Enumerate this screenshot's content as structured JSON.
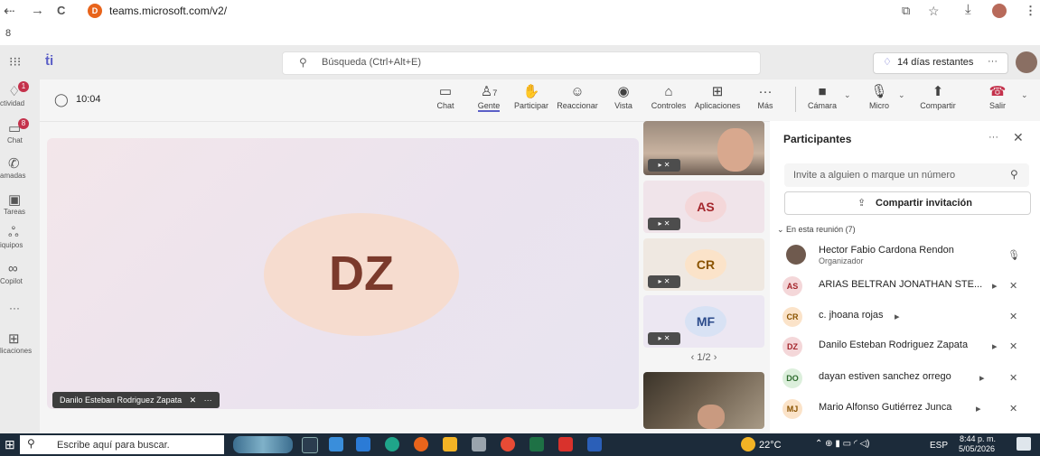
{
  "browser": {
    "back": "⇠",
    "forward": "→",
    "reload": "C",
    "url": "teams.microsoft.com/v2/",
    "favicon_letter": "D",
    "bookmark_glyph": "8"
  },
  "teams_header": {
    "search_placeholder": "Búsqueda (Ctrl+Alt+E)",
    "trial_text": "14 días restantes",
    "more": "···"
  },
  "rail": {
    "items": [
      {
        "label": "ctividad",
        "icon": "bell-icon",
        "badge": "1"
      },
      {
        "label": "Chat",
        "icon": "chat-icon",
        "badge": "8"
      },
      {
        "label": "amadas",
        "icon": "phone-icon",
        "badge": ""
      },
      {
        "label": "Tareas",
        "icon": "tasks-icon",
        "badge": ""
      },
      {
        "label": "iquipos",
        "icon": "teams-icon",
        "badge": ""
      },
      {
        "label": "Copilot",
        "icon": "copilot-icon",
        "badge": ""
      },
      {
        "label": "···",
        "icon": "more-icon",
        "badge": ""
      },
      {
        "label": "licaciones",
        "icon": "apps-icon",
        "badge": ""
      }
    ]
  },
  "meeting": {
    "timer": "10:04",
    "people_count": "7",
    "tools": [
      {
        "label": "Chat"
      },
      {
        "label": "Gente"
      },
      {
        "label": "Participar"
      },
      {
        "label": "Reaccionar"
      },
      {
        "label": "Vista"
      },
      {
        "label": "Controles"
      },
      {
        "label": "Aplicaciones"
      },
      {
        "label": "Más"
      },
      {
        "label": "Cámara"
      },
      {
        "label": "Micro"
      },
      {
        "label": "Compartir"
      },
      {
        "label": "Salir"
      }
    ]
  },
  "stage": {
    "initials": "DZ",
    "name": "Danilo Esteban Rodriguez Zapata",
    "more": "···"
  },
  "tiles": [
    {
      "initials": "",
      "kind": "video"
    },
    {
      "initials": "AS",
      "kind": "avatar"
    },
    {
      "initials": "CR",
      "kind": "avatar"
    },
    {
      "initials": "MF",
      "kind": "avatar"
    },
    {
      "initials": "",
      "kind": "video"
    }
  ],
  "pager": "1/2",
  "participants_pane": {
    "title": "Participantes",
    "invite_placeholder": "Invite a alguien o marque un número",
    "share_invite": "Compartir invitación",
    "section": "En esta reunión (7)",
    "people": [
      {
        "initials": "",
        "name": "Hector Fabio Cardona Rendon",
        "role": "Organizador"
      },
      {
        "initials": "AS",
        "name": "ARIAS BELTRAN JONATHAN STE...",
        "role": ""
      },
      {
        "initials": "CR",
        "name": "c. jhoana rojas",
        "role": ""
      },
      {
        "initials": "DZ",
        "name": "Danilo Esteban Rodriguez Zapata",
        "role": ""
      },
      {
        "initials": "DO",
        "name": "dayan estiven sanchez orrego",
        "role": ""
      },
      {
        "initials": "MJ",
        "name": "Mario Alfonso Gutiérrez Junca",
        "role": ""
      }
    ]
  },
  "taskbar": {
    "search_placeholder": "Escribe aquí para buscar.",
    "temperature": "22°C",
    "language": "ESP",
    "time": "8:44 p. m.",
    "date": "5/05/2026"
  }
}
